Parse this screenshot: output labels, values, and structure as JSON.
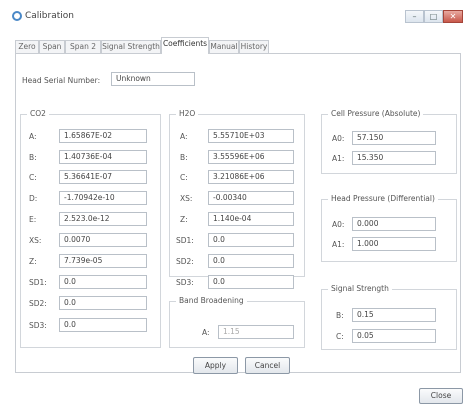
{
  "window": {
    "title": "Calibration",
    "minimize_label": "–",
    "maximize_label": "□",
    "close_label": "✕"
  },
  "tabs": [
    "Zero",
    "Span",
    "Span 2",
    "Signal Strength",
    "Coefficients",
    "Manual",
    "History"
  ],
  "active_tab": "Coefficients",
  "head_serial": {
    "label": "Head Serial Number:",
    "value": "Unknown"
  },
  "co2": {
    "title": "CO2",
    "rows": [
      {
        "label": "A:",
        "value": "1.65867E-02"
      },
      {
        "label": "B:",
        "value": "1.40736E-04"
      },
      {
        "label": "C:",
        "value": "5.36641E-07"
      },
      {
        "label": "D:",
        "value": "-1.70942e-10"
      },
      {
        "label": "E:",
        "value": "2.523.0e-12"
      },
      {
        "label": "XS:",
        "value": "0.0070"
      },
      {
        "label": "Z:",
        "value": "7.739e-05"
      },
      {
        "label": "SD1:",
        "value": "0.0"
      },
      {
        "label": "SD2:",
        "value": "0.0"
      },
      {
        "label": "SD3:",
        "value": "0.0"
      }
    ]
  },
  "h2o": {
    "title": "H2O",
    "rows": [
      {
        "label": "A:",
        "value": "5.55710E+03"
      },
      {
        "label": "B:",
        "value": "3.55596E+06"
      },
      {
        "label": "C:",
        "value": "3.21086E+06"
      },
      {
        "label": "XS:",
        "value": "-0.00340"
      },
      {
        "label": "Z:",
        "value": "1.140e-04"
      },
      {
        "label": "SD1:",
        "value": "0.0"
      },
      {
        "label": "SD2:",
        "value": "0.0"
      },
      {
        "label": "SD3:",
        "value": "0.0"
      }
    ]
  },
  "band_broadening": {
    "title": "Band Broadening",
    "rows": [
      {
        "label": "A:",
        "value": "1.15"
      }
    ]
  },
  "cell_pressure_abs": {
    "title": "Cell Pressure (Absolute)",
    "rows": [
      {
        "label": "A0:",
        "value": "57.150"
      },
      {
        "label": "A1:",
        "value": "15.350"
      }
    ]
  },
  "head_pressure_diff": {
    "title": "Head Pressure (Differential)",
    "rows": [
      {
        "label": "A0:",
        "value": "0.000"
      },
      {
        "label": "A1:",
        "value": "1.000"
      }
    ]
  },
  "signal_strength": {
    "title": "Signal Strength",
    "rows": [
      {
        "label": "B:",
        "value": "0.15"
      },
      {
        "label": "C:",
        "value": "0.05"
      }
    ]
  },
  "buttons": {
    "apply": "Apply",
    "cancel": "Cancel",
    "close": "Close"
  }
}
